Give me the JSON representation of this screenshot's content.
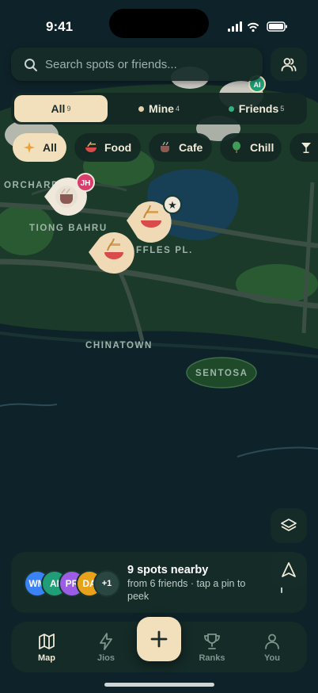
{
  "status": {
    "time": "9:41"
  },
  "search": {
    "placeholder": "Search spots or friends..."
  },
  "scope": [
    {
      "label": "All",
      "count": "9"
    },
    {
      "label": "Mine",
      "count": "4"
    },
    {
      "label": "Friends",
      "count": "5"
    }
  ],
  "categories": [
    "All",
    "Food",
    "Cafe",
    "Chill"
  ],
  "map": {
    "labels": [
      "ORCHARD",
      "TIONG BAHRU",
      "FFLES PL.",
      "CHINATOWN",
      "SENTOSA"
    ],
    "pins": [
      {
        "category": "cafe",
        "badge": "JH"
      },
      {
        "category": "food",
        "badge": "★"
      },
      {
        "category": "food"
      },
      {
        "badge": "AI"
      }
    ]
  },
  "nearby": {
    "avatars": [
      {
        "initials": "WM",
        "color": "#3b82f6"
      },
      {
        "initials": "AI",
        "color": "#1f9e77"
      },
      {
        "initials": "PR",
        "color": "#9b5de5"
      },
      {
        "initials": "DA",
        "color": "#e8a21a"
      }
    ],
    "more": "+1",
    "title": "9 spots nearby",
    "subtitle": "from 6 friends · tap a pin to peek"
  },
  "nav": [
    "Map",
    "Jios",
    "Ranks",
    "You"
  ],
  "colors": {
    "accent": "#f2dfbc",
    "friends_dot": "#2fb27f",
    "mine_dot": "#e6d0a8"
  }
}
